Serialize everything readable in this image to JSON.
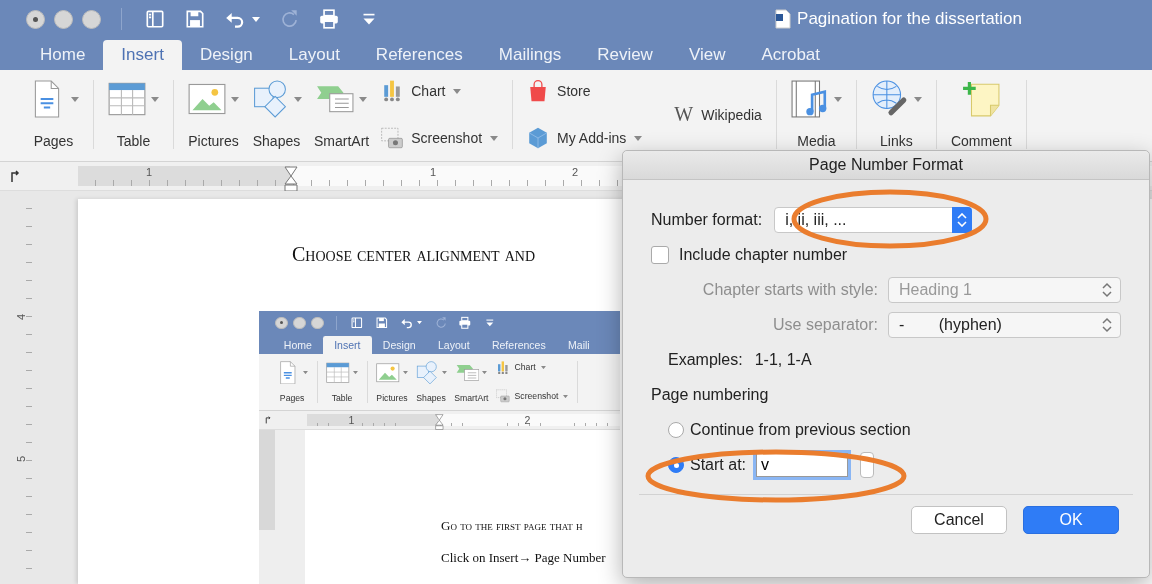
{
  "window": {
    "title": "Pagination for the dissertation",
    "quick_access": [
      {
        "disabled": false,
        "dropdown": false
      },
      {
        "disabled": false,
        "dropdown": false
      },
      {
        "disabled": false,
        "dropdown": true
      },
      {
        "disabled": true,
        "dropdown": false
      },
      {
        "disabled": false,
        "dropdown": false
      },
      {
        "disabled": false,
        "dropdown": false
      }
    ]
  },
  "tabs": [
    {
      "label": "Home",
      "selected": false
    },
    {
      "label": "Insert",
      "selected": true
    },
    {
      "label": "Design",
      "selected": false
    },
    {
      "label": "Layout",
      "selected": false
    },
    {
      "label": "References",
      "selected": false
    },
    {
      "label": "Mailings",
      "selected": false
    },
    {
      "label": "Review",
      "selected": false
    },
    {
      "label": "View",
      "selected": false
    },
    {
      "label": "Acrobat",
      "selected": false
    }
  ],
  "ribbon": {
    "groups": [
      {
        "items": [
          {
            "kind": "large",
            "label": "Pages",
            "dropdown": true
          }
        ]
      },
      {
        "items": [
          {
            "kind": "large",
            "label": "Table",
            "dropdown": true
          }
        ]
      },
      {
        "items": [
          {
            "kind": "large",
            "label": "Pictures",
            "dropdown": true
          },
          {
            "kind": "large",
            "label": "Shapes",
            "dropdown": true
          },
          {
            "kind": "large",
            "label": "SmartArt",
            "dropdown": true
          },
          {
            "kind": "small",
            "label": "Chart",
            "dropdown": true
          },
          {
            "kind": "small",
            "label": "Screenshot",
            "dropdown": true
          }
        ]
      },
      {
        "items": [
          {
            "kind": "small",
            "label": "Store",
            "dropdown": false
          },
          {
            "kind": "small",
            "label": "My Add-ins",
            "dropdown": true
          },
          {
            "kind": "logo",
            "logo": "W",
            "label": "Wikipedia",
            "dropdown": false
          }
        ]
      },
      {
        "items": [
          {
            "kind": "large",
            "label": "Media",
            "dropdown": true
          }
        ]
      },
      {
        "items": [
          {
            "kind": "large",
            "label": "Links",
            "dropdown": true
          }
        ]
      },
      {
        "items": [
          {
            "kind": "large",
            "label": "Comment",
            "dropdown": false
          }
        ]
      }
    ]
  },
  "ruler": {
    "numbers": [
      "1",
      "1",
      "2"
    ]
  },
  "document": {
    "vertical_ruler": {
      "numbers": [
        "4",
        "5"
      ]
    },
    "heading": "Choose center alignment and",
    "embedded_screenshot": {
      "quick_access": [
        {
          "disabled": false,
          "dropdown": false
        },
        {
          "disabled": false,
          "dropdown": false
        },
        {
          "disabled": false,
          "dropdown": true
        },
        {
          "disabled": true,
          "dropdown": false
        },
        {
          "disabled": false,
          "dropdown": false
        },
        {
          "disabled": false,
          "dropdown": false
        }
      ],
      "tabs": [
        {
          "label": "Home",
          "selected": false
        },
        {
          "label": "Insert",
          "selected": true
        },
        {
          "label": "Design",
          "selected": false
        },
        {
          "label": "Layout",
          "selected": false
        },
        {
          "label": "References",
          "selected": false
        },
        {
          "label": "Maili",
          "selected": false
        }
      ],
      "ribbon": {
        "groups": [
          {
            "items": [
              {
                "kind": "large",
                "label": "Pages",
                "dropdown": true
              }
            ]
          },
          {
            "items": [
              {
                "kind": "large",
                "label": "Table",
                "dropdown": true
              }
            ]
          },
          {
            "items": [
              {
                "kind": "large",
                "label": "Pictures",
                "dropdown": true
              },
              {
                "kind": "large",
                "label": "Shapes",
                "dropdown": true
              },
              {
                "kind": "large",
                "label": "SmartArt",
                "dropdown": true
              },
              {
                "kind": "small",
                "label": "Chart",
                "dropdown": true
              },
              {
                "kind": "small",
                "label": "Screenshot",
                "dropdown": true
              }
            ]
          }
        ]
      },
      "ruler": {
        "numbers": [
          "1",
          "2"
        ]
      },
      "paragraphs": [
        "Go to the first page that h",
        "Click on Insert→ Page Number"
      ]
    }
  },
  "dialog": {
    "title": "Page Number Format",
    "number_format": {
      "label": "Number format:",
      "value": "i, ii, iii, ..."
    },
    "include_chapter": {
      "label": "Include chapter number",
      "checked": false
    },
    "chapter_style": {
      "label": "Chapter starts with style:",
      "value": "Heading 1",
      "label_disabled": true,
      "value_disabled": true
    },
    "separator": {
      "label": "Use separator:",
      "value": "- (hyphen)",
      "label_disabled": true,
      "value_disabled": false
    },
    "examples": {
      "label": "Examples:",
      "value": "1-1, 1-A"
    },
    "page_numbering": {
      "heading": "Page numbering",
      "options": [
        {
          "kind": "plain",
          "label": "Continue from previous section",
          "selected": false
        },
        {
          "kind": "input",
          "label": "Start at:",
          "selected": true,
          "value": "v"
        }
      ]
    },
    "buttons": [
      {
        "label": "Cancel",
        "default": false
      },
      {
        "label": "OK",
        "default": true
      }
    ]
  }
}
